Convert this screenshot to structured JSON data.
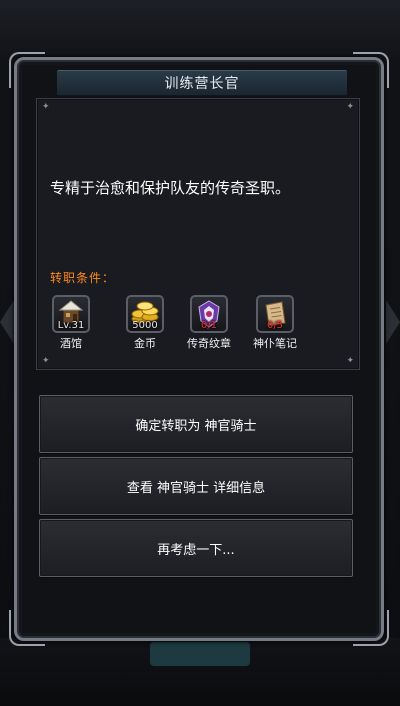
{
  "dialog": {
    "title": "训练营长官",
    "description": "专精于治愈和保护队友的传奇圣职。",
    "conditions_label": "转职条件：",
    "requirements": [
      {
        "name": "酒馆",
        "qty": "Lv.31",
        "qty_color": "#e8e8e8",
        "icon": "tavern-building-icon"
      },
      {
        "name": "金币",
        "qty": "5000",
        "qty_color": "#e8e8e8",
        "icon": "gold-coins-icon"
      },
      {
        "name": "传奇纹章",
        "qty": "0/1",
        "qty_color": "#ff2a2a",
        "icon": "legendary-crest-icon"
      },
      {
        "name": "神仆笔记",
        "qty": "0/5",
        "qty_color": "#ff2a2a",
        "icon": "scroll-notes-icon"
      }
    ],
    "buttons": {
      "confirm": "确定转职为 神官骑士",
      "details": "查看 神官骑士 详细信息",
      "reconsider": "再考虑一下..."
    }
  },
  "colors": {
    "title_bar": "#2a3a48",
    "condition_label": "#ff8a1a",
    "insufficient": "#ff2a2a"
  }
}
